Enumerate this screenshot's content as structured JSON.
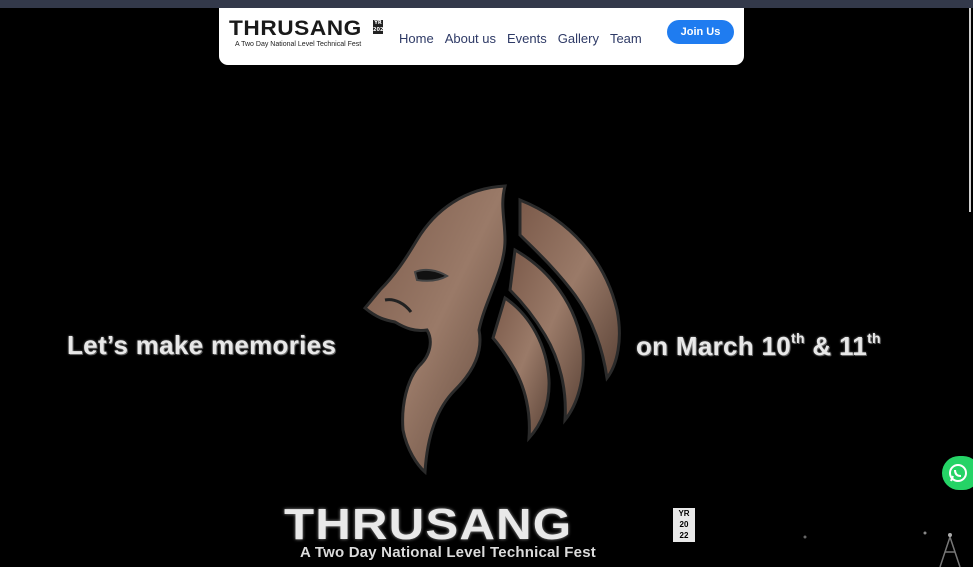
{
  "nav": {
    "logo_text": "THRUSANG",
    "logo_badge": "YR 2022",
    "logo_subtitle": "A Two Day National Level Technical Fest",
    "links": [
      "Home",
      "About us",
      "Events",
      "Gallery",
      "Team"
    ],
    "cta_label": "Join Us"
  },
  "hero": {
    "tagline_left": "Let’s make memories",
    "tagline_right_prefix": "on March 10",
    "sup1": "th",
    "mid": " & 11",
    "sup2": "th",
    "title": "THRUSANG",
    "badge_yr": "YR",
    "badge_20": "20",
    "badge_22": "22",
    "subtitle": "A Two Day National Level Technical Fest"
  },
  "colors": {
    "accent": "#1f7cf0",
    "nav_text": "#2e3a66",
    "whatsapp": "#25d366",
    "background": "#000000"
  },
  "icons": {
    "hero_emblem": "lion-head-icon",
    "float_button": "whatsapp-icon"
  }
}
